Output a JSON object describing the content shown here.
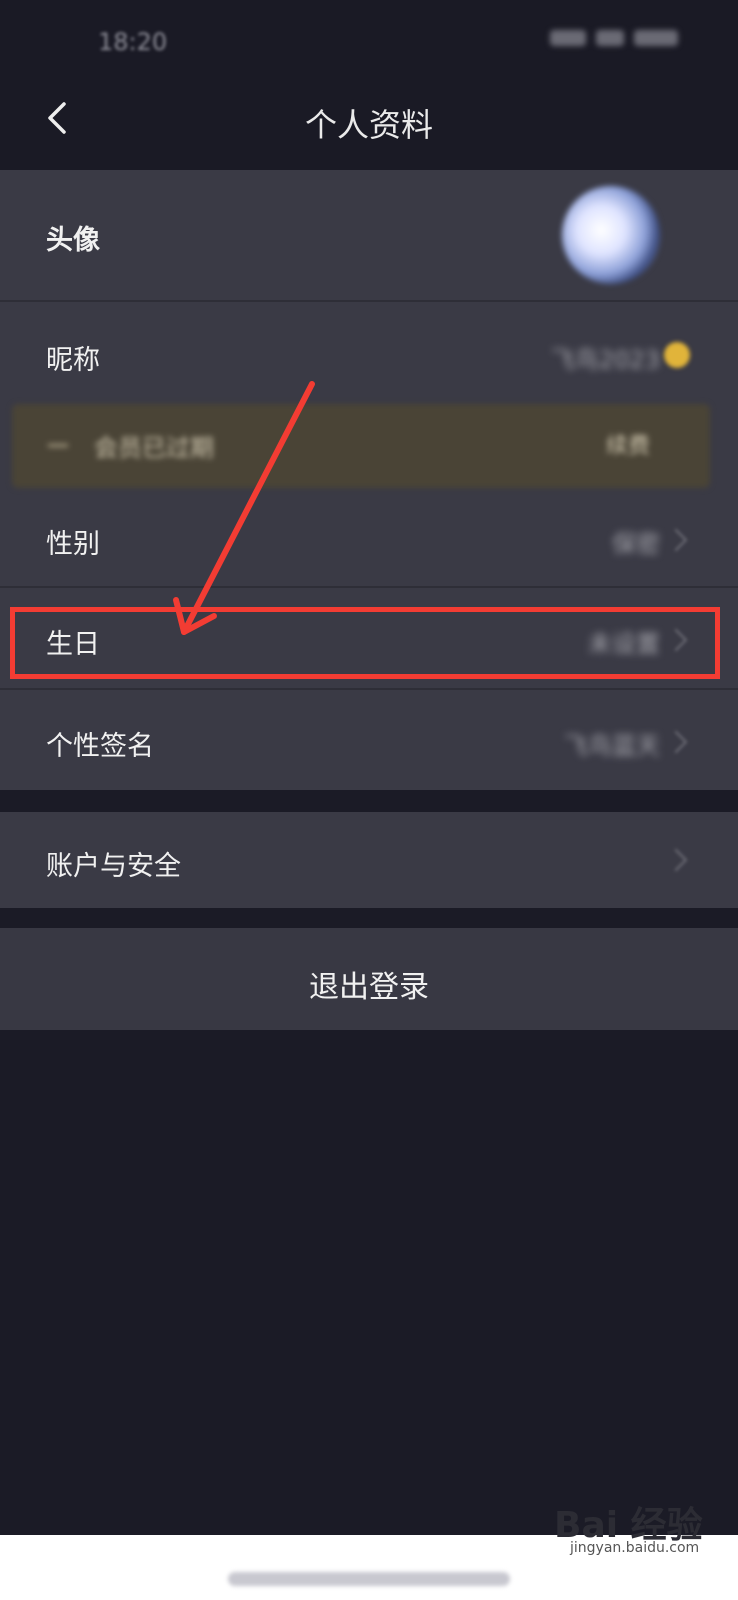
{
  "status": {
    "time": "18:20"
  },
  "nav": {
    "title": "个人资料"
  },
  "profile": {
    "rows": [
      {
        "label": "头像"
      },
      {
        "label": "昵称",
        "value": "飞鸟2023"
      },
      {
        "label": "性别",
        "value": "保密"
      },
      {
        "label": "生日",
        "value": "未设置"
      },
      {
        "label": "个性签名",
        "value": "飞鸟蓝天"
      }
    ],
    "member_banner": {
      "text": "会员已过期",
      "action": "续费"
    }
  },
  "account": {
    "label": "账户与安全"
  },
  "logout": {
    "label": "退出登录"
  },
  "watermark": {
    "brand": "Bai  经验",
    "url": "jingyan.baidu.com"
  },
  "colors": {
    "annotation": "#f33c33",
    "background": "#1b1b26",
    "panel": "#3a3a45"
  }
}
